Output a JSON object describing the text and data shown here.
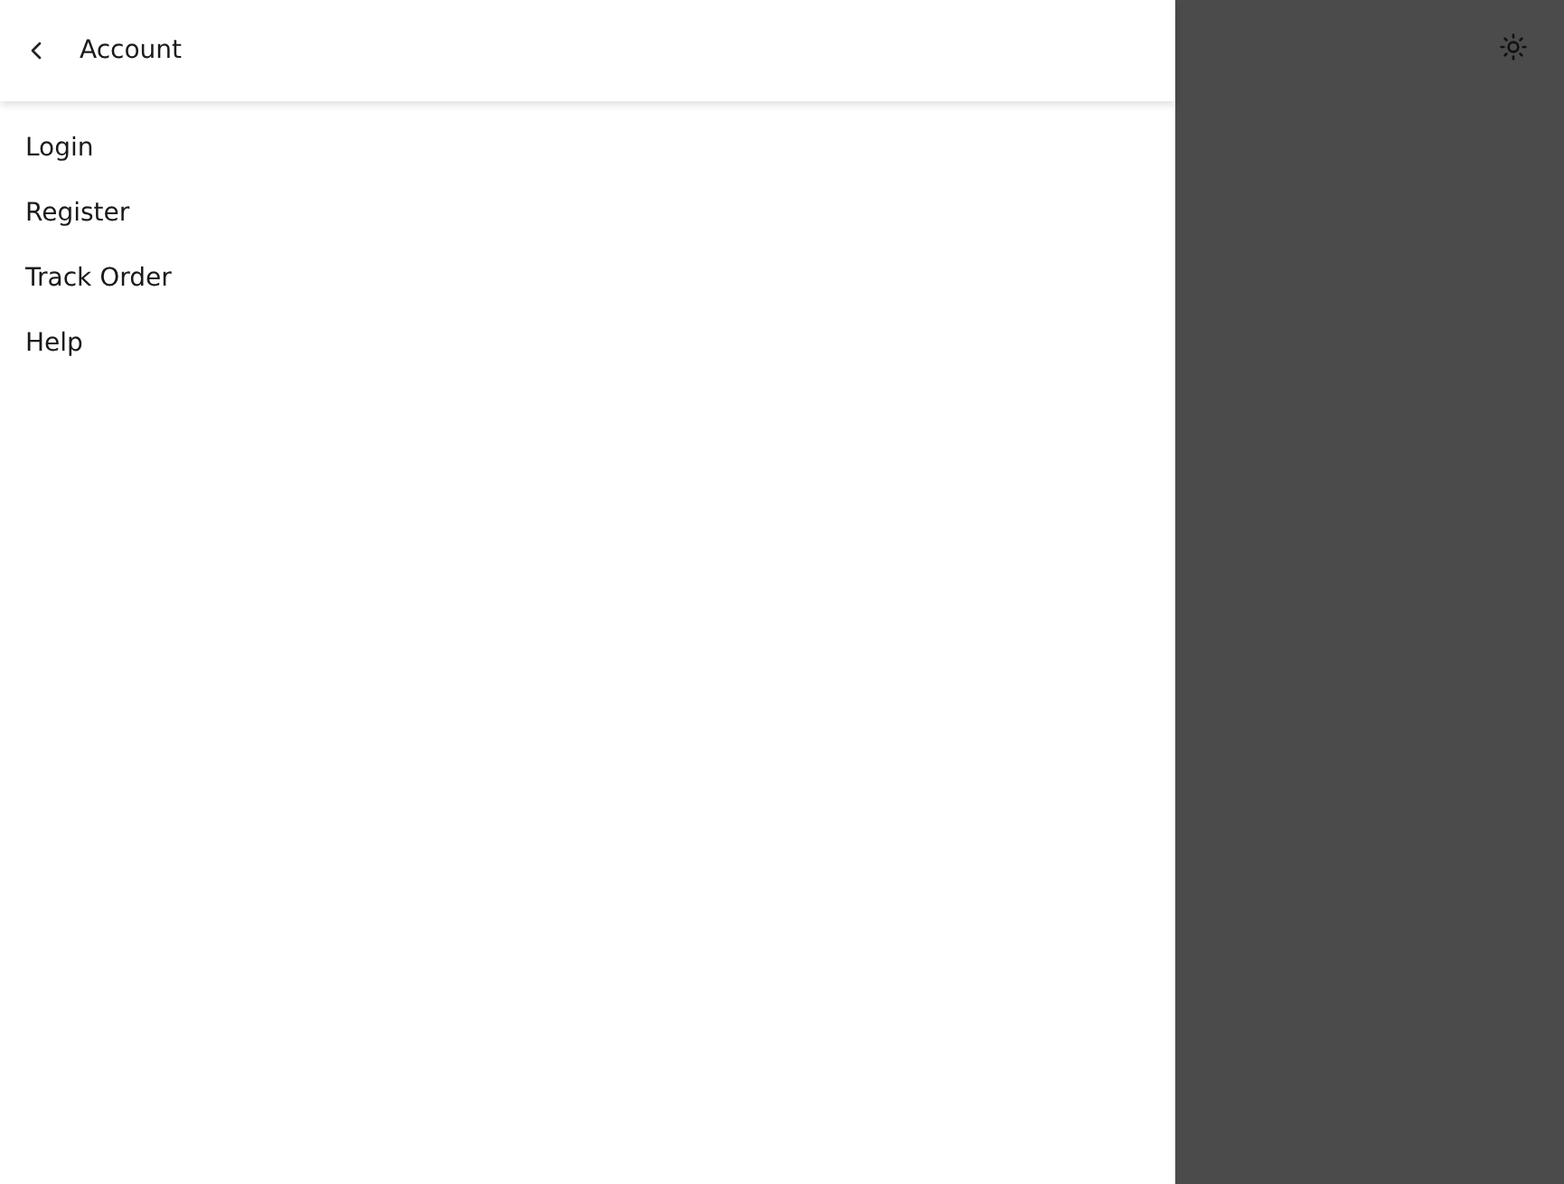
{
  "panel": {
    "title": "Account"
  },
  "menu": [
    {
      "label": "Login"
    },
    {
      "label": "Register"
    },
    {
      "label": "Track Order"
    },
    {
      "label": "Help"
    }
  ]
}
